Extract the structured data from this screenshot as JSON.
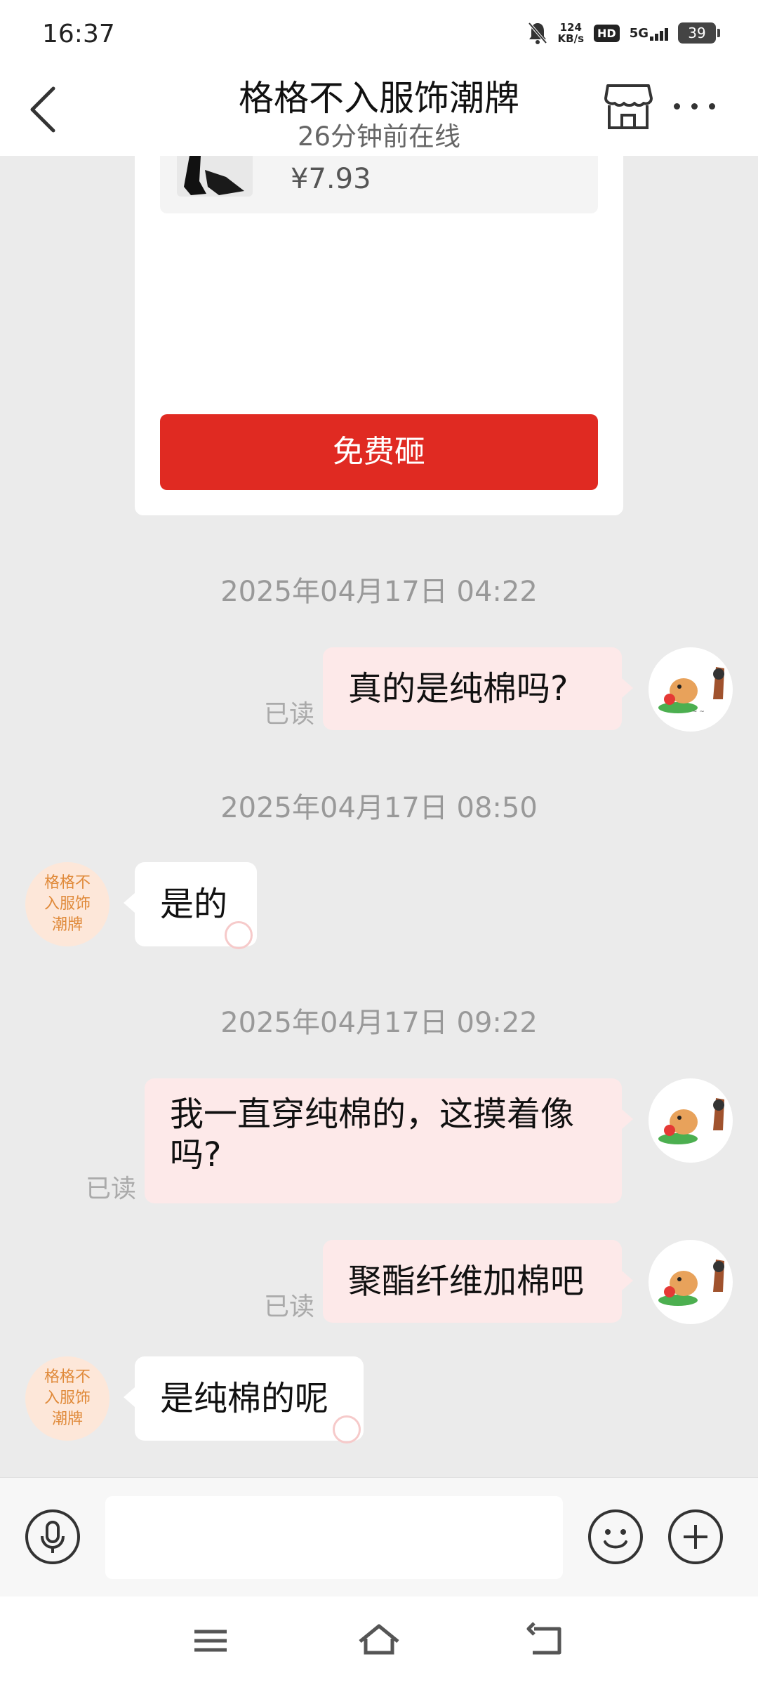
{
  "status_bar": {
    "time": "16:37",
    "net_speed_value": "124",
    "net_speed_unit": "KB/s",
    "hd_label": "HD",
    "network_label": "5G",
    "battery": "39"
  },
  "header": {
    "title": "格格不入服饰潮牌",
    "subtitle": "26分钟前在线"
  },
  "product_card": {
    "price": "¥7.93",
    "button_label": "免费砸"
  },
  "messages": [
    {
      "timestamp": "2025年04月17日 04:22"
    },
    {
      "sender": "me",
      "text": "真的是纯棉吗?",
      "status": "已读"
    },
    {
      "timestamp": "2025年04月17日 08:50"
    },
    {
      "sender": "shop",
      "text": "是的"
    },
    {
      "timestamp": "2025年04月17日 09:22"
    },
    {
      "sender": "me",
      "text_line1": "我一直穿纯棉的，这摸着像",
      "text_line2": "吗?",
      "status": "已读"
    },
    {
      "sender": "me",
      "text": "聚酯纤维加棉吧",
      "status": "已读"
    },
    {
      "sender": "shop",
      "text": "是纯棉的呢"
    }
  ],
  "shop_avatar": {
    "line1": "格格不",
    "line2": "入服饰",
    "line3": "潮牌"
  },
  "colors": {
    "accent_red": "#e02a22",
    "my_bubble": "#fde9e9",
    "shop_avatar_bg": "#fde7d9"
  },
  "icons": [
    "back-arrow-icon",
    "shop-icon",
    "more-dots-icon",
    "microphone-icon",
    "smiley-icon",
    "plus-icon",
    "menu-icon",
    "home-icon",
    "back-icon"
  ]
}
